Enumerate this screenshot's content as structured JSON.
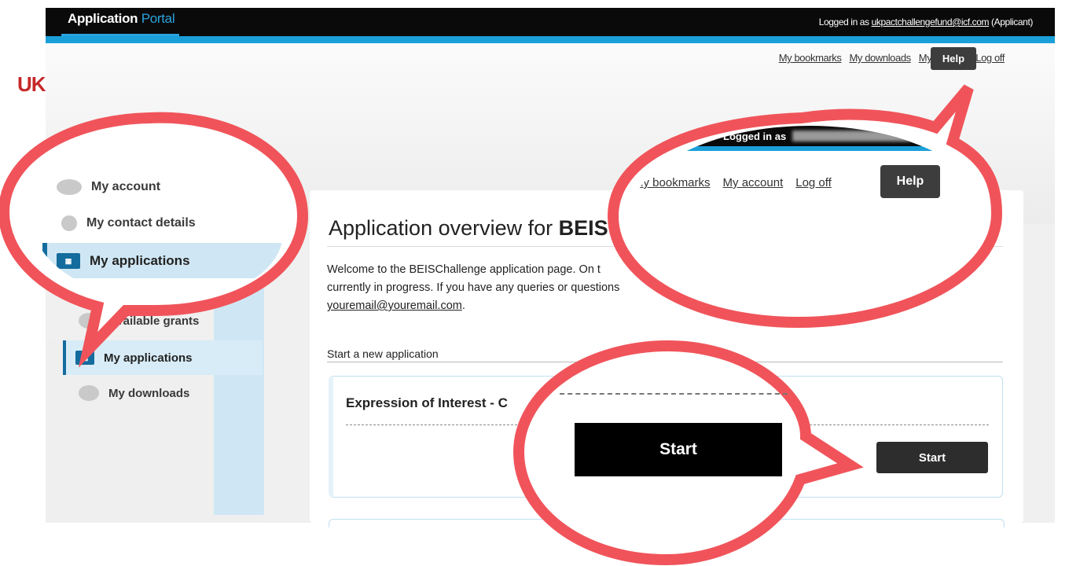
{
  "header": {
    "app_title_main": "Application",
    "app_title_accent": "Portal",
    "logged_in_prefix": "Logged in as",
    "user_email": "ukpactchallengefund@icf.com",
    "user_role": "(Applicant)"
  },
  "top_links": {
    "bookmarks": "My bookmarks",
    "downloads": "My downloads",
    "account": "My account",
    "logoff": "Log off",
    "help": "Help"
  },
  "logo": {
    "text": "UK"
  },
  "sidebar": {
    "items": [
      {
        "label": "Available grants"
      },
      {
        "label": "My applications"
      },
      {
        "label": "My downloads"
      }
    ]
  },
  "main": {
    "title_prefix": "Application overview for",
    "title_bold": "BEIS",
    "welcome_line1": "Welcome to the BEISChallenge application page. On t",
    "welcome_line2": "currently in progress. If you have any queries or questions",
    "welcome_email": "youremail@youremail.com",
    "welcome_end": ".",
    "new_app_label": "Start a new application",
    "eoi_title": "Expression of Interest - C",
    "start_label": "Start"
  },
  "callout_left": {
    "items": [
      {
        "label": "My account"
      },
      {
        "label": "My contact details"
      },
      {
        "label": "My applications"
      }
    ]
  },
  "callout_right": {
    "logged_in_fragment": "Logged in as",
    "role_fragment": "Applicant)",
    "bookmarks": "My bookmarks",
    "account": "My account",
    "logoff": "Log off",
    "help": "Help"
  },
  "callout_bottom": {
    "start_label": "Start"
  },
  "colors": {
    "accent_blue": "#1a9fd8",
    "callout_red": "#f0545a",
    "topbar_black": "#0a0a0a",
    "sidebar_blue": "#cfe7f4"
  }
}
